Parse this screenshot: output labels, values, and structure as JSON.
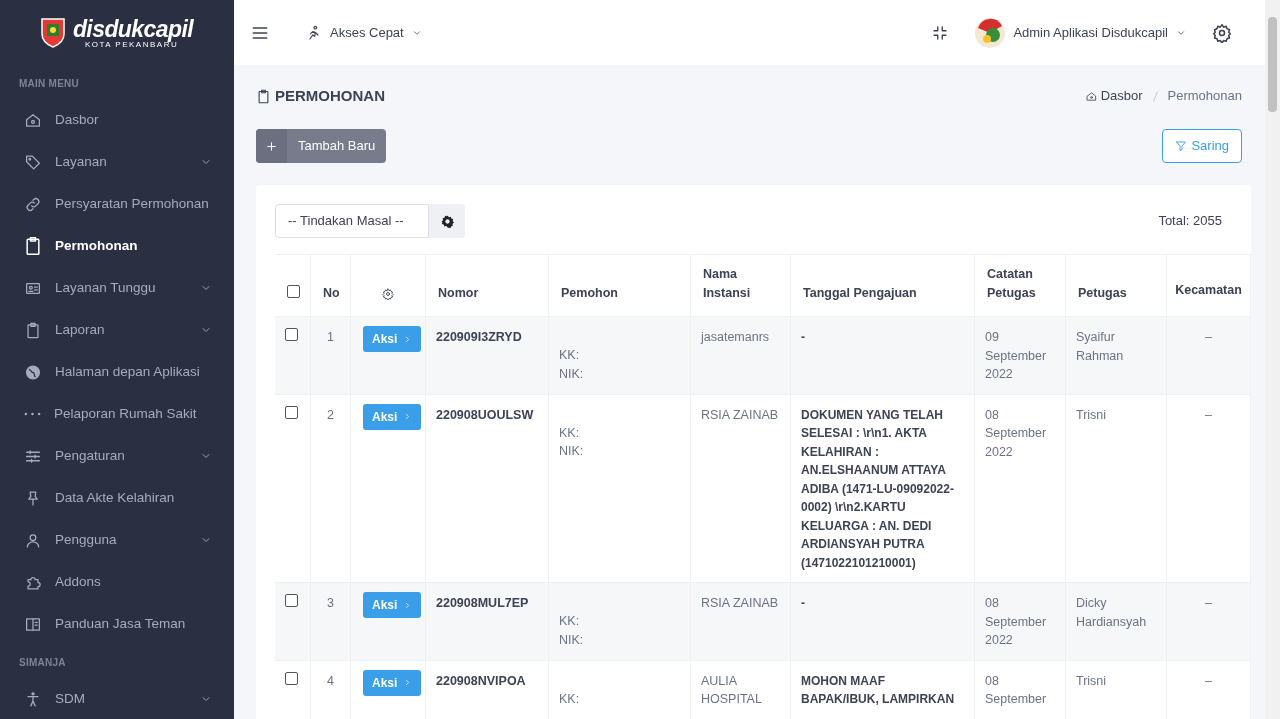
{
  "sidebar": {
    "logo": {
      "title": "disdukcapil",
      "subtitle": "KOTA PEKANBARU"
    },
    "sections": [
      {
        "title": "MAIN MENU",
        "items": [
          {
            "label": "Dasbor",
            "selected": false,
            "expandable": false
          },
          {
            "label": "Layanan",
            "selected": false,
            "expandable": true
          },
          {
            "label": "Persyaratan Permohonan",
            "selected": false,
            "expandable": false
          },
          {
            "label": "Permohonan",
            "selected": true,
            "expandable": false
          },
          {
            "label": "Layanan Tunggu",
            "selected": false,
            "expandable": true
          },
          {
            "label": "Laporan",
            "selected": false,
            "expandable": true
          },
          {
            "label": "Halaman depan Aplikasi",
            "selected": false,
            "expandable": false
          },
          {
            "label": "Pelaporan Rumah Sakit",
            "selected": false,
            "expandable": false
          },
          {
            "label": "Pengaturan",
            "selected": false,
            "expandable": true
          },
          {
            "label": "Data Akte Kelahiran",
            "selected": false,
            "expandable": false
          },
          {
            "label": "Pengguna",
            "selected": false,
            "expandable": true
          },
          {
            "label": "Addons",
            "selected": false,
            "expandable": false
          },
          {
            "label": "Panduan Jasa Teman",
            "selected": false,
            "expandable": false
          }
        ]
      },
      {
        "title": "SIMANJA",
        "items": [
          {
            "label": "SDM",
            "selected": false,
            "expandable": true
          }
        ]
      }
    ]
  },
  "topbar": {
    "quick_access": "Akses Cepat",
    "user": "Admin Aplikasi Disdukcapil"
  },
  "page": {
    "title": "PERMOHONAN",
    "breadcrumb": [
      "Dasbor",
      "Permohonan"
    ],
    "add_button": "Tambah Baru",
    "filter_button": "Saring"
  },
  "table": {
    "bulk_action": "-- Tindakan Masal --",
    "total": "Total: 2055",
    "header_checked": false,
    "columns": [
      "No",
      "Nomor",
      "Pemohon",
      "Nama Instansi",
      "Tanggal Pengajuan",
      "Catatan Petugas",
      "Petugas",
      "Kecamatan"
    ],
    "rows": [
      {
        "checked": false,
        "no": "1",
        "action": "Aksi",
        "nomor": "220909I3ZRYD",
        "pemohon": [
          "KK:",
          "NIK:"
        ],
        "nama_instansi": "jasatemanrs",
        "tanggal_pengajuan": "-",
        "catatan_petugas": "09 September 2022",
        "petugas": "Syaifur Rahman",
        "kecamatan": "–"
      },
      {
        "checked": false,
        "no": "2",
        "action": "Aksi",
        "nomor": "220908UOULSW",
        "pemohon": [
          "KK:",
          "NIK:"
        ],
        "nama_instansi": "RSIA ZAINAB",
        "tanggal_pengajuan": "DOKUMEN YANG TELAH SELESAI : \\r\\n1. AKTA KELAHIRAN : AN.ELSHAANUM ATTAYA ADIBA (1471-LU-09092022-0002) \\r\\n2.KARTU KELUARGA : AN. DEDI ARDIANSYAH PUTRA (1471022101210001)",
        "catatan_petugas": "08 September 2022",
        "petugas": "Trisni",
        "kecamatan": "–"
      },
      {
        "checked": false,
        "no": "3",
        "action": "Aksi",
        "nomor": "220908MUL7EP",
        "pemohon": [
          "KK:",
          "NIK:"
        ],
        "nama_instansi": "RSIA ZAINAB",
        "tanggal_pengajuan": "-",
        "catatan_petugas": "08 September 2022",
        "petugas": "Dicky Hardiansyah",
        "kecamatan": "–"
      },
      {
        "checked": false,
        "no": "4",
        "action": "Aksi",
        "nomor": "220908NVIPOA",
        "pemohon": [
          "KK:"
        ],
        "nama_instansi": "AULIA HOSPITAL",
        "tanggal_pengajuan": "MOHON MAAF BAPAK/IBUK, LAMPIRKAN",
        "catatan_petugas": "08 September",
        "petugas": "Trisni",
        "kecamatan": "–"
      }
    ]
  }
}
